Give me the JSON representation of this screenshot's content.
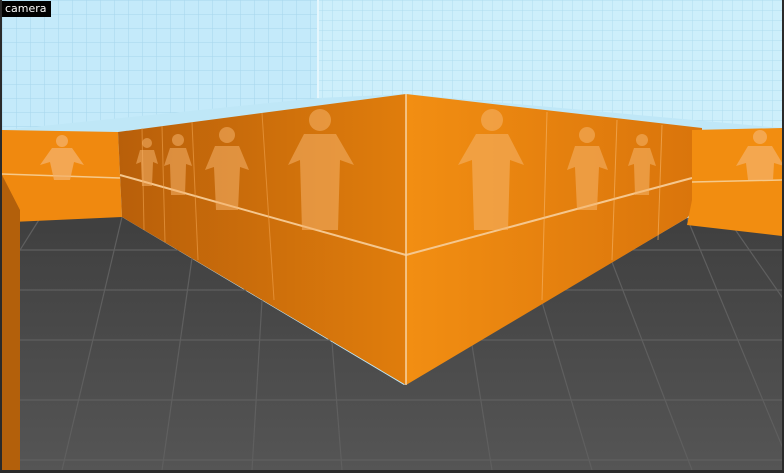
{
  "viewport": {
    "label": "camera",
    "colors": {
      "sky_grid": "#bfe7f7",
      "sky_lines": "#9fd0e8",
      "floor": "#555555",
      "floor_lines": "#6a6a6a",
      "wall_light": "#f08a0e",
      "wall_dark": "#c9690b",
      "figure": "#f3b064",
      "seam": "#f6c98a"
    }
  }
}
